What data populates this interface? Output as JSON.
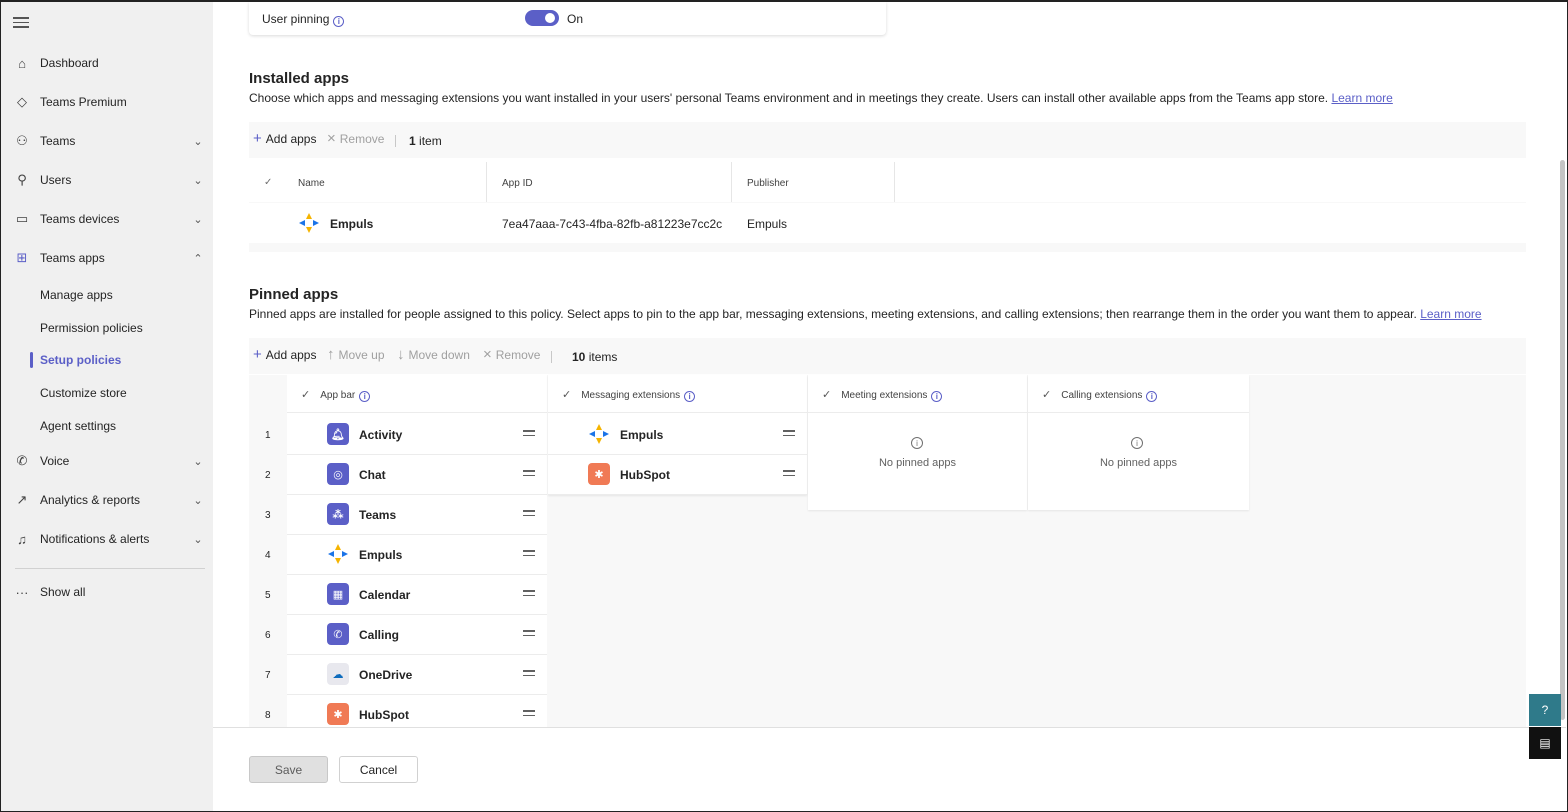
{
  "sidebar": {
    "items": [
      {
        "label": "Dashboard",
        "icon": "home-icon"
      },
      {
        "label": "Teams Premium",
        "icon": "diamond-icon"
      },
      {
        "label": "Teams",
        "icon": "teams-icon"
      },
      {
        "label": "Users",
        "icon": "users-icon"
      },
      {
        "label": "Teams devices",
        "icon": "devices-icon"
      },
      {
        "label": "Teams apps",
        "icon": "apps-icon"
      },
      {
        "label": "Voice",
        "icon": "phone-icon"
      },
      {
        "label": "Analytics & reports",
        "icon": "chart-icon"
      },
      {
        "label": "Notifications & alerts",
        "icon": "bell-icon"
      }
    ],
    "subitems": [
      "Manage apps",
      "Permission policies",
      "Setup policies",
      "Customize store",
      "Agent settings"
    ],
    "show_all": "Show all"
  },
  "user_pinning": {
    "label": "User pinning",
    "state": "On"
  },
  "installed": {
    "title": "Installed apps",
    "description": "Choose which apps and messaging extensions you want installed in your users' personal Teams environment and in meetings they create. Users can install other available apps from the Teams app store.",
    "learn_more": "Learn more",
    "toolbar": {
      "add": "Add apps",
      "remove": "Remove",
      "count": "1",
      "count_label": "item"
    },
    "columns": [
      "Name",
      "App ID",
      "Publisher"
    ],
    "rows": [
      {
        "name": "Empuls",
        "app_id": "7ea47aaa-7c43-4fba-82fb-a81223e7cc2c",
        "publisher": "Empuls"
      }
    ]
  },
  "pinned": {
    "title": "Pinned apps",
    "description": "Pinned apps are installed for people assigned to this policy. Select apps to pin to the app bar, messaging extensions, meeting extensions, and calling extensions; then rearrange them in the order you want them to appear.",
    "learn_more": "Learn more",
    "toolbar": {
      "add": "Add apps",
      "move_up": "Move up",
      "move_down": "Move down",
      "remove": "Remove",
      "count": "10",
      "count_label": "items"
    },
    "app_bar": {
      "title": "App bar",
      "rows": [
        {
          "n": "1",
          "name": "Activity"
        },
        {
          "n": "2",
          "name": "Chat"
        },
        {
          "n": "3",
          "name": "Teams"
        },
        {
          "n": "4",
          "name": "Empuls"
        },
        {
          "n": "5",
          "name": "Calendar"
        },
        {
          "n": "6",
          "name": "Calling"
        },
        {
          "n": "7",
          "name": "OneDrive"
        },
        {
          "n": "8",
          "name": "HubSpot"
        }
      ]
    },
    "messaging": {
      "title": "Messaging extensions",
      "rows": [
        {
          "name": "Empuls"
        },
        {
          "name": "HubSpot"
        }
      ]
    },
    "meeting": {
      "title": "Meeting extensions",
      "empty": "No pinned apps"
    },
    "calling": {
      "title": "Calling extensions",
      "empty": "No pinned apps"
    }
  },
  "footer": {
    "save": "Save",
    "cancel": "Cancel"
  },
  "colors": {
    "accent": "#5b5fc7",
    "hubspot": "#f07a55"
  }
}
